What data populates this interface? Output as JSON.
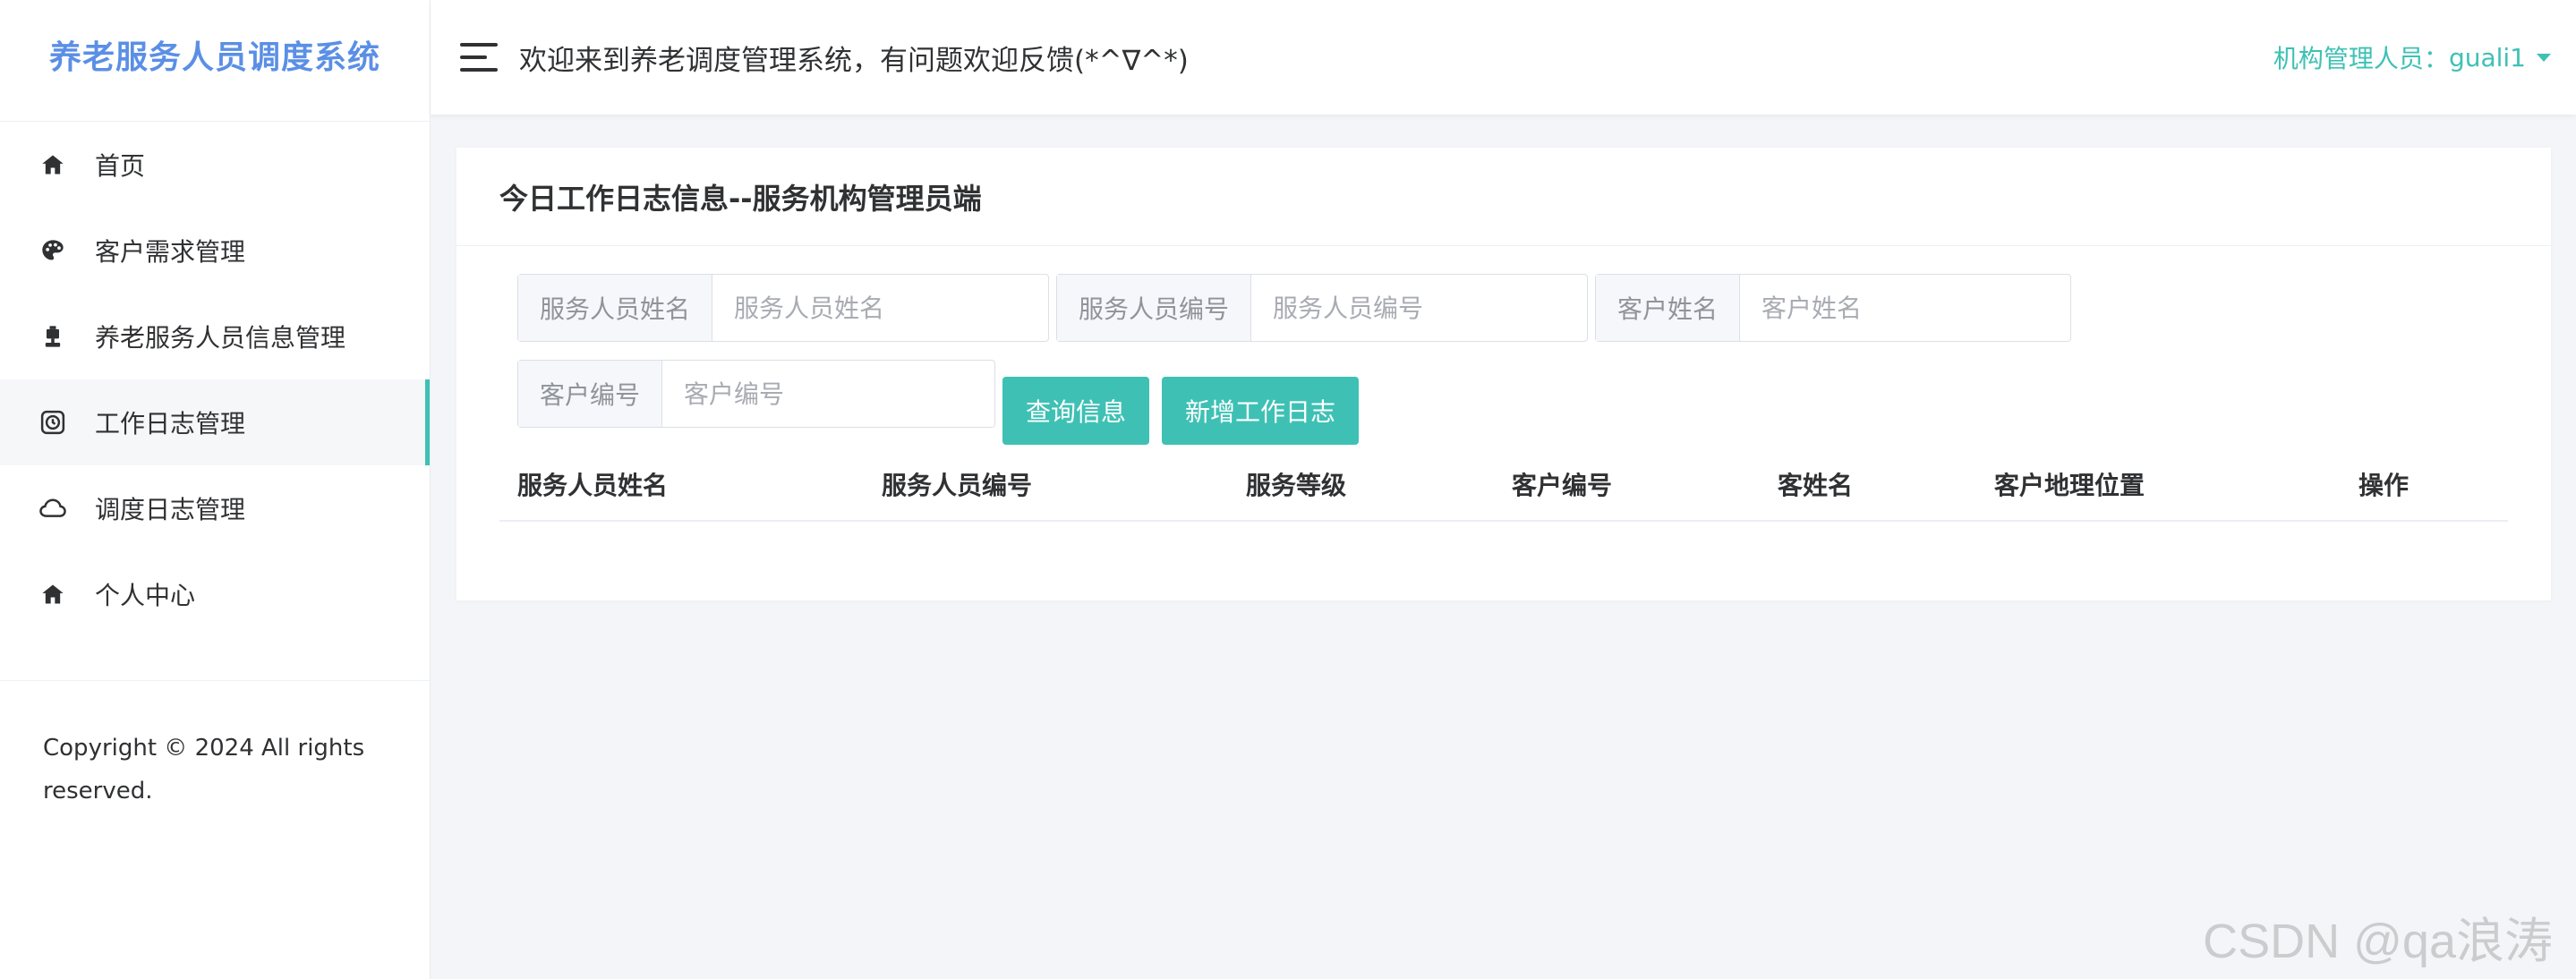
{
  "sidebar": {
    "brand": "养老服务人员调度系统",
    "items": [
      {
        "label": "首页",
        "icon": "home-icon"
      },
      {
        "label": "客户需求管理",
        "icon": "palette-icon"
      },
      {
        "label": "养老服务人员信息管理",
        "icon": "trophy-icon"
      },
      {
        "label": "工作日志管理",
        "icon": "clock-icon",
        "active": true
      },
      {
        "label": "调度日志管理",
        "icon": "cloud-icon"
      },
      {
        "label": "个人中心",
        "icon": "home-icon"
      }
    ],
    "copyright": "Copyright © 2024 All rights reserved."
  },
  "header": {
    "welcome": "欢迎来到养老调度管理系统，有问题欢迎反馈(*^∇^*)",
    "user_label": "机构管理人员：",
    "username": "guali1"
  },
  "card": {
    "title": "今日工作日志信息--服务机构管理员端",
    "filters": {
      "staff_name": {
        "label": "服务人员姓名",
        "placeholder": "服务人员姓名",
        "value": ""
      },
      "staff_id": {
        "label": "服务人员编号",
        "placeholder": "服务人员编号",
        "value": ""
      },
      "customer_name": {
        "label": "客户姓名",
        "placeholder": "客户姓名",
        "value": ""
      },
      "customer_id": {
        "label": "客户编号",
        "placeholder": "客户编号",
        "value": ""
      }
    },
    "buttons": {
      "query": "查询信息",
      "add": "新增工作日志"
    },
    "table": {
      "columns": [
        "服务人员姓名",
        "服务人员编号",
        "服务等级",
        "客户编号",
        "客姓名",
        "客户地理位置",
        "操作"
      ],
      "rows": []
    }
  },
  "watermark": "CSDN @qa浪涛",
  "colors": {
    "accent": "#3ec1b4",
    "brand": "#5b8fe6"
  }
}
